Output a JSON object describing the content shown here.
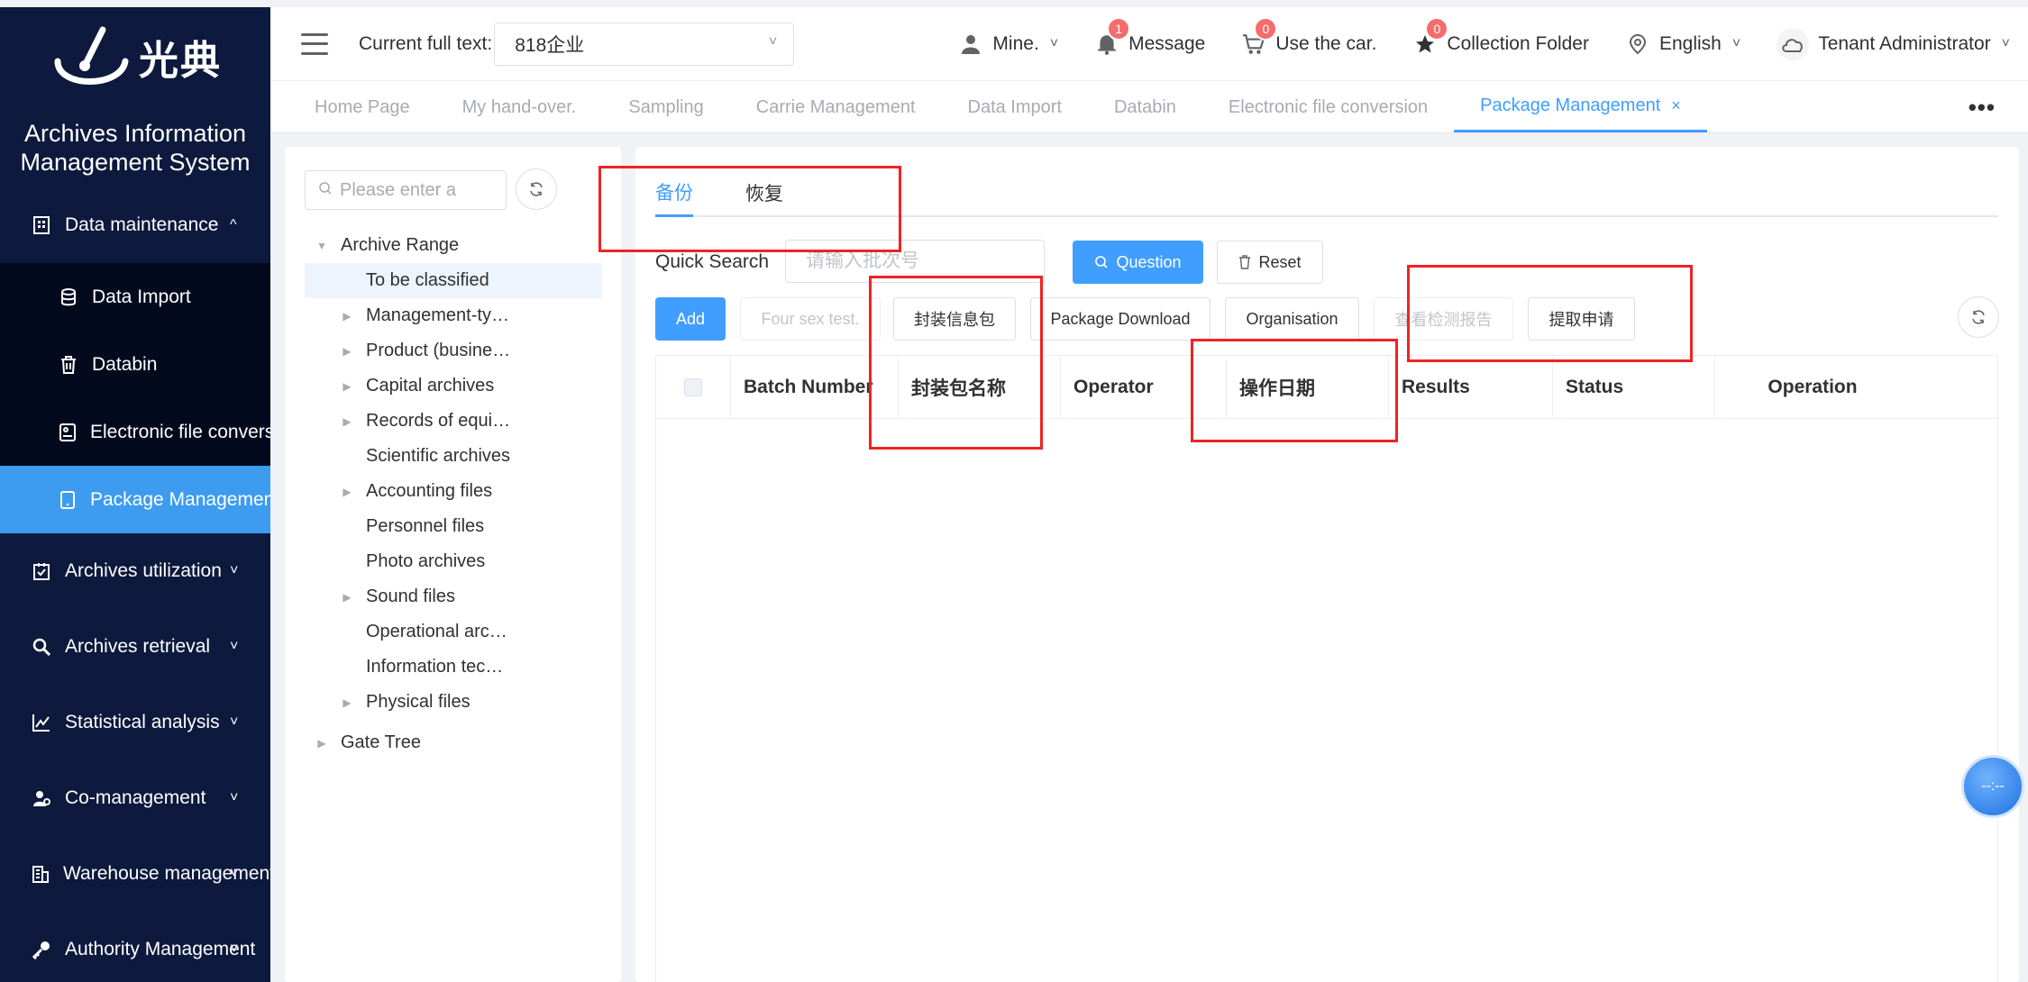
{
  "app": {
    "logo_text": "光典",
    "system_title": "Archives Information Management System"
  },
  "sidebar": {
    "items": [
      {
        "label": "Data maintenance",
        "icon": "building-icon",
        "expanded": true
      },
      {
        "label": "Data Import",
        "icon": "database-import-icon",
        "sub": true
      },
      {
        "label": "Databin",
        "icon": "trash-icon",
        "sub": true
      },
      {
        "label": "Electronic file conversion",
        "icon": "file-convert-icon",
        "sub": true
      },
      {
        "label": "Package Management",
        "icon": "tablet-icon",
        "sub": true,
        "active": true
      },
      {
        "label": "Archives utilization",
        "icon": "clipboard-check-icon"
      },
      {
        "label": "Archives retrieval",
        "icon": "search-icon"
      },
      {
        "label": "Statistical analysis",
        "icon": "chart-line-icon"
      },
      {
        "label": "Co-management",
        "icon": "user-gear-icon"
      },
      {
        "label": "Warehouse management",
        "icon": "warehouse-icon"
      },
      {
        "label": "Authority Management",
        "icon": "key-icon"
      }
    ]
  },
  "topbar": {
    "current_label": "Current full text:",
    "current_value": "818企业",
    "mine": "Mine.",
    "message": "Message",
    "message_count": "1",
    "car": "Use the car.",
    "car_count": "0",
    "collection": "Collection Folder",
    "collection_count": "0",
    "language": "English",
    "user": "Tenant Administrator"
  },
  "tabs": [
    {
      "label": "Home Page"
    },
    {
      "label": "My hand-over."
    },
    {
      "label": "Sampling"
    },
    {
      "label": "Carrie Management"
    },
    {
      "label": "Data Import"
    },
    {
      "label": "Databin"
    },
    {
      "label": "Electronic file conversion"
    },
    {
      "label": "Package Management",
      "active": true
    }
  ],
  "tab_close": "×",
  "tree": {
    "search_placeholder": "Please enter a",
    "nodes": [
      {
        "label": "Archive Range",
        "level": 1,
        "expanded": true
      },
      {
        "label": "To be classified",
        "level": 2,
        "selected": true
      },
      {
        "label": "Management-ty…",
        "level": 2,
        "has_children": true
      },
      {
        "label": "Product (busine…",
        "level": 2,
        "has_children": true
      },
      {
        "label": "Capital archives",
        "level": 2,
        "has_children": true
      },
      {
        "label": "Records of equi…",
        "level": 2,
        "has_children": true
      },
      {
        "label": "Scientific archives",
        "level": 2
      },
      {
        "label": "Accounting files",
        "level": 2,
        "has_children": true
      },
      {
        "label": "Personnel files",
        "level": 2
      },
      {
        "label": "Photo archives",
        "level": 2
      },
      {
        "label": "Sound files",
        "level": 2,
        "has_children": true
      },
      {
        "label": "Operational arc…",
        "level": 2
      },
      {
        "label": "Information tec…",
        "level": 2
      },
      {
        "label": "Physical files",
        "level": 2,
        "has_children": true
      },
      {
        "label": "Gate Tree",
        "level": 1,
        "has_children": true
      }
    ]
  },
  "main": {
    "panel_tabs": [
      {
        "label": "备份",
        "active": true
      },
      {
        "label": "恢复"
      }
    ],
    "quick_search_label": "Quick Search",
    "quick_search_placeholder": "请输入批次号",
    "question_button": "Question",
    "reset_button": "Reset",
    "actions": {
      "add": "Add",
      "four_sex_test": "Four sex test.",
      "package_info": "封装信息包",
      "package_download": "Package Download",
      "organisation": "Organisation",
      "view_report": "查看检测报告",
      "extract_application": "提取申请"
    },
    "table_headers": [
      "Batch Number",
      "封装包名称",
      "Operator",
      "操作日期",
      "Results",
      "Status",
      "Operation"
    ]
  },
  "float_button": "--:--",
  "colors": {
    "sidebar_bg": "#0d1a3e",
    "active_blue": "#3d9cf0",
    "primary": "#409eff",
    "badge": "#f56c6c",
    "annotation": "#f02323"
  }
}
